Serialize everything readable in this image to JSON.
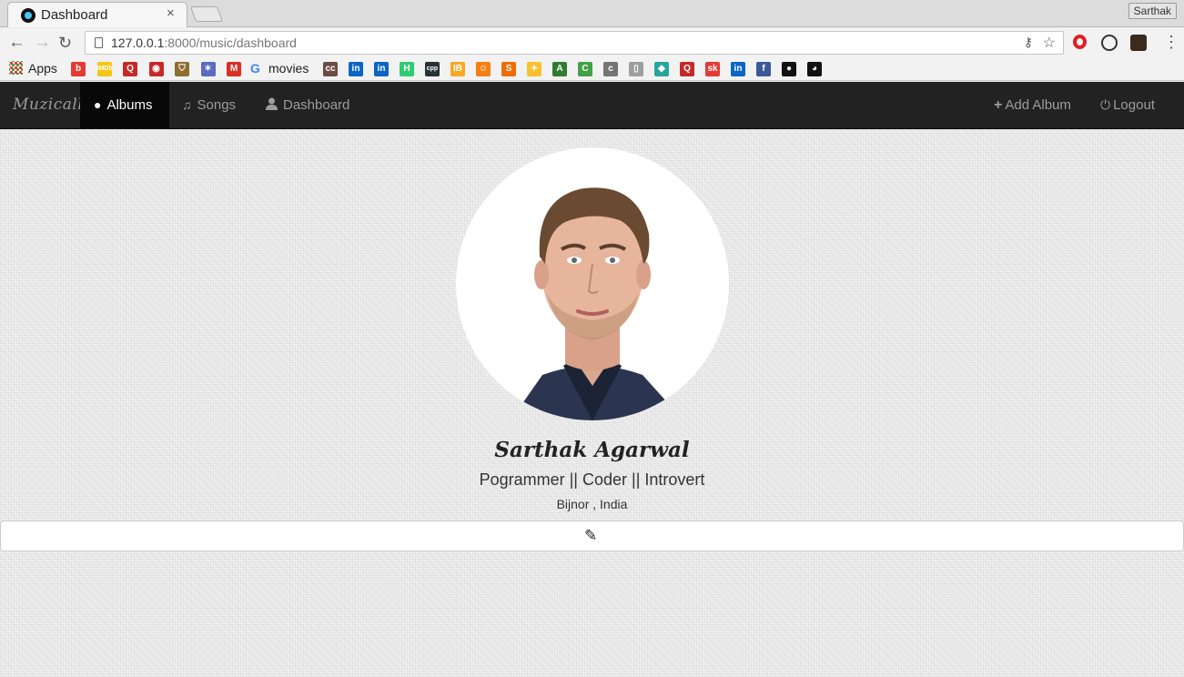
{
  "browser": {
    "tab_title": "Dashboard",
    "tab_close": "×",
    "profile_name": "Sarthak",
    "url_host": "127.0.0.1",
    "url_rest": ":8000/music/dashboard",
    "bookmarks": {
      "apps_label": "Apps",
      "movies_label": "movies",
      "g_letter": "G",
      "icons": [
        {
          "name": "bookmark-red-icon",
          "glyph": "b",
          "color": "#e53935"
        },
        {
          "name": "bookmark-imdb-icon",
          "glyph": "IMDb",
          "color": "#f5c518"
        },
        {
          "name": "bookmark-quora-icon",
          "glyph": "Q",
          "color": "#c62828"
        },
        {
          "name": "bookmark-ball-icon",
          "glyph": "◉",
          "color": "#c62828"
        },
        {
          "name": "bookmark-shield-icon",
          "glyph": "⛉",
          "color": "#8d6e2f"
        },
        {
          "name": "bookmark-rabbit-icon",
          "glyph": "✶",
          "color": "#5c6bc0"
        },
        {
          "name": "bookmark-gmail-icon",
          "glyph": "M",
          "color": "#d93025"
        }
      ],
      "icons2": [
        {
          "name": "bookmark-cc-icon",
          "glyph": "cc",
          "color": "#6d4c41"
        },
        {
          "name": "bookmark-linkedin-icon",
          "glyph": "in",
          "color": "#0a66c2"
        },
        {
          "name": "bookmark-linkedin-2-icon",
          "glyph": "in",
          "color": "#0a66c2"
        },
        {
          "name": "bookmark-hackerearth-icon",
          "glyph": "H",
          "color": "#2ecc71"
        },
        {
          "name": "bookmark-cpp-icon",
          "glyph": "cpp",
          "color": "#263238"
        },
        {
          "name": "bookmark-ib-icon",
          "glyph": "IB",
          "color": "#f9a825"
        },
        {
          "name": "bookmark-person-icon",
          "glyph": "☺",
          "color": "#f57f17"
        },
        {
          "name": "bookmark-swirl-icon",
          "glyph": "S",
          "color": "#ef6c00"
        },
        {
          "name": "bookmark-bulb-icon",
          "glyph": "✦",
          "color": "#fbc02d"
        },
        {
          "name": "bookmark-terminal-icon",
          "glyph": "A",
          "color": "#2e7d32"
        },
        {
          "name": "bookmark-c-icon",
          "glyph": "C",
          "color": "#43a047"
        },
        {
          "name": "bookmark-doc-icon",
          "glyph": "c",
          "color": "#757575"
        },
        {
          "name": "bookmark-page-icon",
          "glyph": "▯",
          "color": "#9e9e9e"
        },
        {
          "name": "bookmark-gem-icon",
          "glyph": "◆",
          "color": "#26a69a"
        },
        {
          "name": "bookmark-quora-2-icon",
          "glyph": "Q",
          "color": "#c62828"
        },
        {
          "name": "bookmark-sk-icon",
          "glyph": "sk",
          "color": "#e53935"
        },
        {
          "name": "bookmark-linkedin-3-icon",
          "glyph": "in",
          "color": "#0a66c2"
        },
        {
          "name": "bookmark-facebook-icon",
          "glyph": "f",
          "color": "#3b5998"
        },
        {
          "name": "bookmark-muzic-icon",
          "glyph": "●",
          "color": "#111111"
        },
        {
          "name": "bookmark-github-icon",
          "glyph": "◕",
          "color": "#111111"
        }
      ]
    }
  },
  "navbar": {
    "brand": "Muzicall",
    "items": [
      {
        "label": "Albums",
        "active": true
      },
      {
        "label": "Songs",
        "active": false
      },
      {
        "label": "Dashboard",
        "active": false
      }
    ],
    "right_items": [
      {
        "label": "Add Album"
      },
      {
        "label": "Logout"
      }
    ]
  },
  "profile": {
    "name": "Sarthak Agarwal",
    "tagline": "Pogrammer || Coder || Introvert",
    "location": "Bijnor , India"
  },
  "colors": {
    "navbar_bg": "#222222",
    "navbar_active": "#080808",
    "nav_text": "#9d9d9d"
  }
}
